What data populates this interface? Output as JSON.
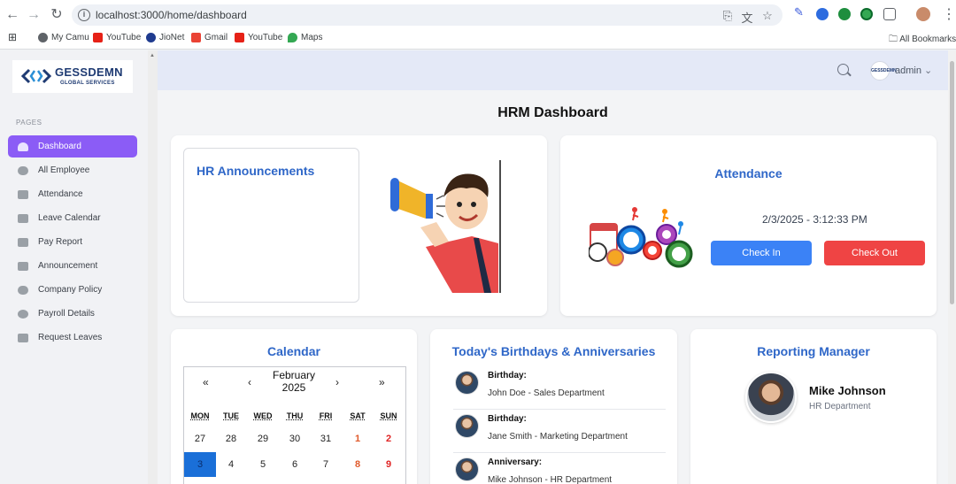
{
  "browser": {
    "url": "localhost:3000/home/dashboard",
    "bookmarks": [
      "My Camu",
      "YouTube",
      "JioNet",
      "Gmail",
      "YouTube",
      "Maps"
    ],
    "all_bookmarks": "All Bookmarks"
  },
  "sidebar": {
    "logo_title": "GESSDEMN",
    "logo_sub": "GLOBAL SERVICES",
    "section": "PAGES",
    "items": [
      {
        "label": "Dashboard",
        "icon": "dashboard-icon",
        "active": true
      },
      {
        "label": "All Employee",
        "icon": "people-icon"
      },
      {
        "label": "Attendance",
        "icon": "calendar-icon"
      },
      {
        "label": "Leave Calendar",
        "icon": "layers-icon"
      },
      {
        "label": "Pay Report",
        "icon": "layers-icon"
      },
      {
        "label": "Announcement",
        "icon": "layers-icon"
      },
      {
        "label": "Company Policy",
        "icon": "people-icon"
      },
      {
        "label": "Payroll Details",
        "icon": "chat-icon"
      },
      {
        "label": "Request Leaves",
        "icon": "layers-icon"
      }
    ]
  },
  "header": {
    "user": "admin",
    "avatar_text": "GESSDEMN"
  },
  "page_title": "HRM Dashboard",
  "announcements": {
    "title": "HR Announcements"
  },
  "attendance": {
    "title": "Attendance",
    "datetime": "2/3/2025 - 3:12:33 PM",
    "check_in": "Check In",
    "check_out": "Check Out"
  },
  "calendar": {
    "title": "Calendar",
    "month_line1": "February",
    "month_line2": "2025",
    "prev_year": "«",
    "prev_month": "‹",
    "next_month": "›",
    "next_year": "»",
    "dow": [
      "MON",
      "TUE",
      "WED",
      "THU",
      "FRI",
      "SAT",
      "SUN"
    ],
    "week1": [
      "27",
      "28",
      "29",
      "30",
      "31",
      "1",
      "2"
    ],
    "week2": [
      "3",
      "4",
      "5",
      "6",
      "7",
      "8",
      "9"
    ]
  },
  "birthdays": {
    "title": "Today's Birthdays & Anniversaries",
    "items": [
      {
        "type": "Birthday:",
        "text": "John Doe - Sales Department"
      },
      {
        "type": "Birthday:",
        "text": "Jane Smith - Marketing Department"
      },
      {
        "type": "Anniversary:",
        "text": "Mike Johnson - HR Department"
      }
    ]
  },
  "manager": {
    "title": "Reporting Manager",
    "name": "Mike Johnson",
    "dept": "HR Department"
  }
}
